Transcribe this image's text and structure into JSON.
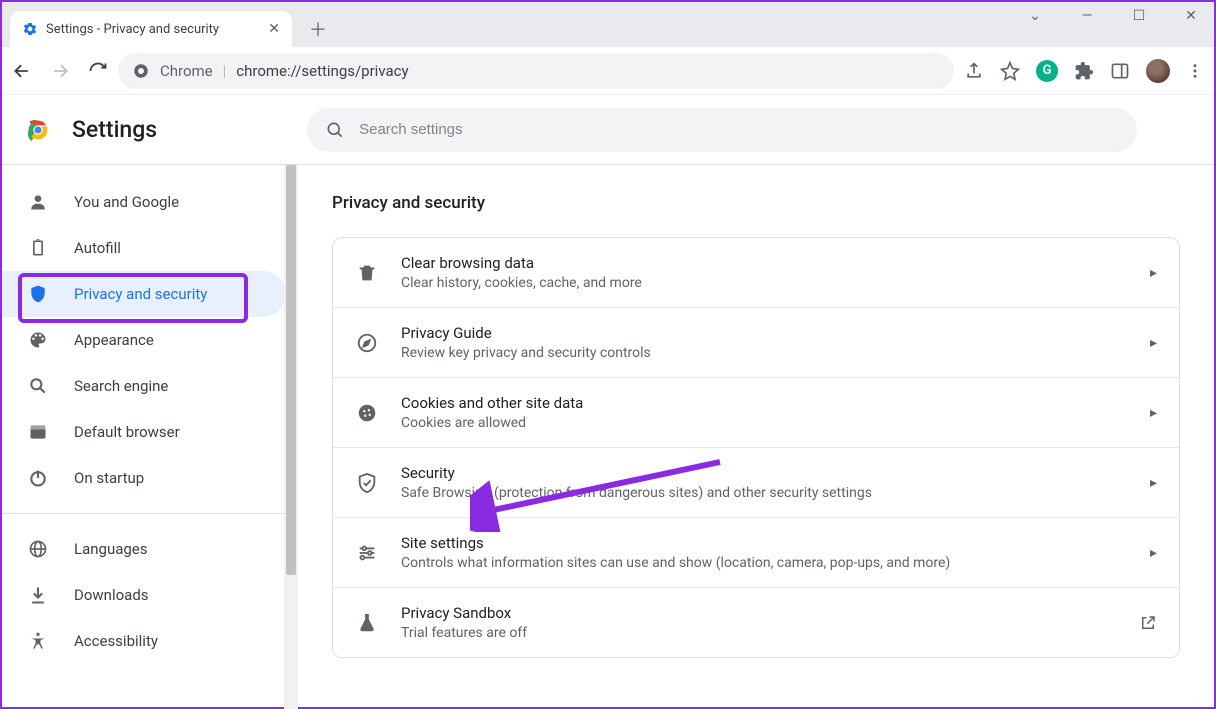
{
  "window": {
    "tab_title": "Settings - Privacy and security"
  },
  "toolbar": {
    "omnibox_label": "Chrome",
    "omnibox_url": "chrome://settings/privacy"
  },
  "header": {
    "title": "Settings",
    "search_placeholder": "Search settings"
  },
  "sidebar": {
    "items": [
      {
        "label": "You and Google"
      },
      {
        "label": "Autofill"
      },
      {
        "label": "Privacy and security"
      },
      {
        "label": "Appearance"
      },
      {
        "label": "Search engine"
      },
      {
        "label": "Default browser"
      },
      {
        "label": "On startup"
      }
    ],
    "items2": [
      {
        "label": "Languages"
      },
      {
        "label": "Downloads"
      },
      {
        "label": "Accessibility"
      }
    ]
  },
  "main": {
    "section_title": "Privacy and security",
    "rows": [
      {
        "title": "Clear browsing data",
        "sub": "Clear history, cookies, cache, and more"
      },
      {
        "title": "Privacy Guide",
        "sub": "Review key privacy and security controls"
      },
      {
        "title": "Cookies and other site data",
        "sub": "Cookies are allowed"
      },
      {
        "title": "Security",
        "sub": "Safe Browsing (protection from dangerous sites) and other security settings"
      },
      {
        "title": "Site settings",
        "sub": "Controls what information sites can use and show (location, camera, pop-ups, and more)"
      },
      {
        "title": "Privacy Sandbox",
        "sub": "Trial features are off"
      }
    ]
  }
}
